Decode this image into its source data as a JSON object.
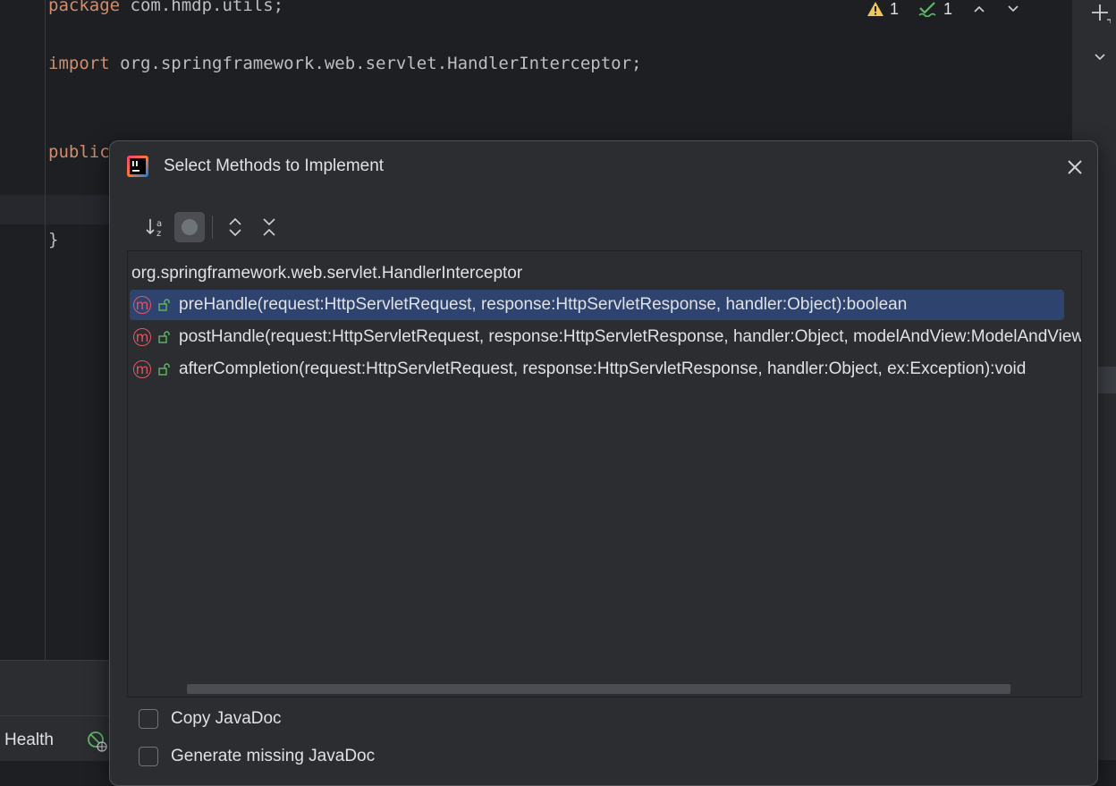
{
  "editor": {
    "code_lines": [
      {
        "kw": "package",
        "rest": " com.hmdp.utils;"
      },
      {
        "kw": "import",
        "rest": " org.springframework.web.servlet.HandlerInterceptor;"
      },
      {
        "kw": "public",
        "rest": ""
      },
      {
        "kw": "",
        "rest": "}"
      }
    ],
    "inspections": {
      "warnings": "1",
      "typos": "1"
    }
  },
  "status_bar": {
    "health_label": "Health"
  },
  "dialog": {
    "title": "Select Methods to Implement",
    "toolbar": {
      "sort_icon": "sort-alphabetically-icon",
      "show_classes_icon": "circle-toggle-icon",
      "expand_icon": "expand-all-icon",
      "collapse_icon": "collapse-all-icon"
    },
    "tree": {
      "root": "org.springframework.web.servlet.HandlerInterceptor",
      "methods": [
        {
          "label": "preHandle(request:HttpServletRequest, response:HttpServletResponse, handler:Object):boolean",
          "selected": true
        },
        {
          "label": "postHandle(request:HttpServletRequest, response:HttpServletResponse, handler:Object, modelAndView:ModelAndView",
          "selected": false
        },
        {
          "label": "afterCompletion(request:HttpServletRequest, response:HttpServletResponse, handler:Object, ex:Exception):void",
          "selected": false
        }
      ],
      "method_badge": "m"
    },
    "options": [
      {
        "label": "Copy JavaDoc",
        "checked": false
      },
      {
        "label": "Generate missing JavaDoc",
        "checked": false
      }
    ]
  },
  "colors": {
    "accent_selection": "#2e436e",
    "keyword": "#cf8e6d",
    "method_icon": "#e55765"
  }
}
